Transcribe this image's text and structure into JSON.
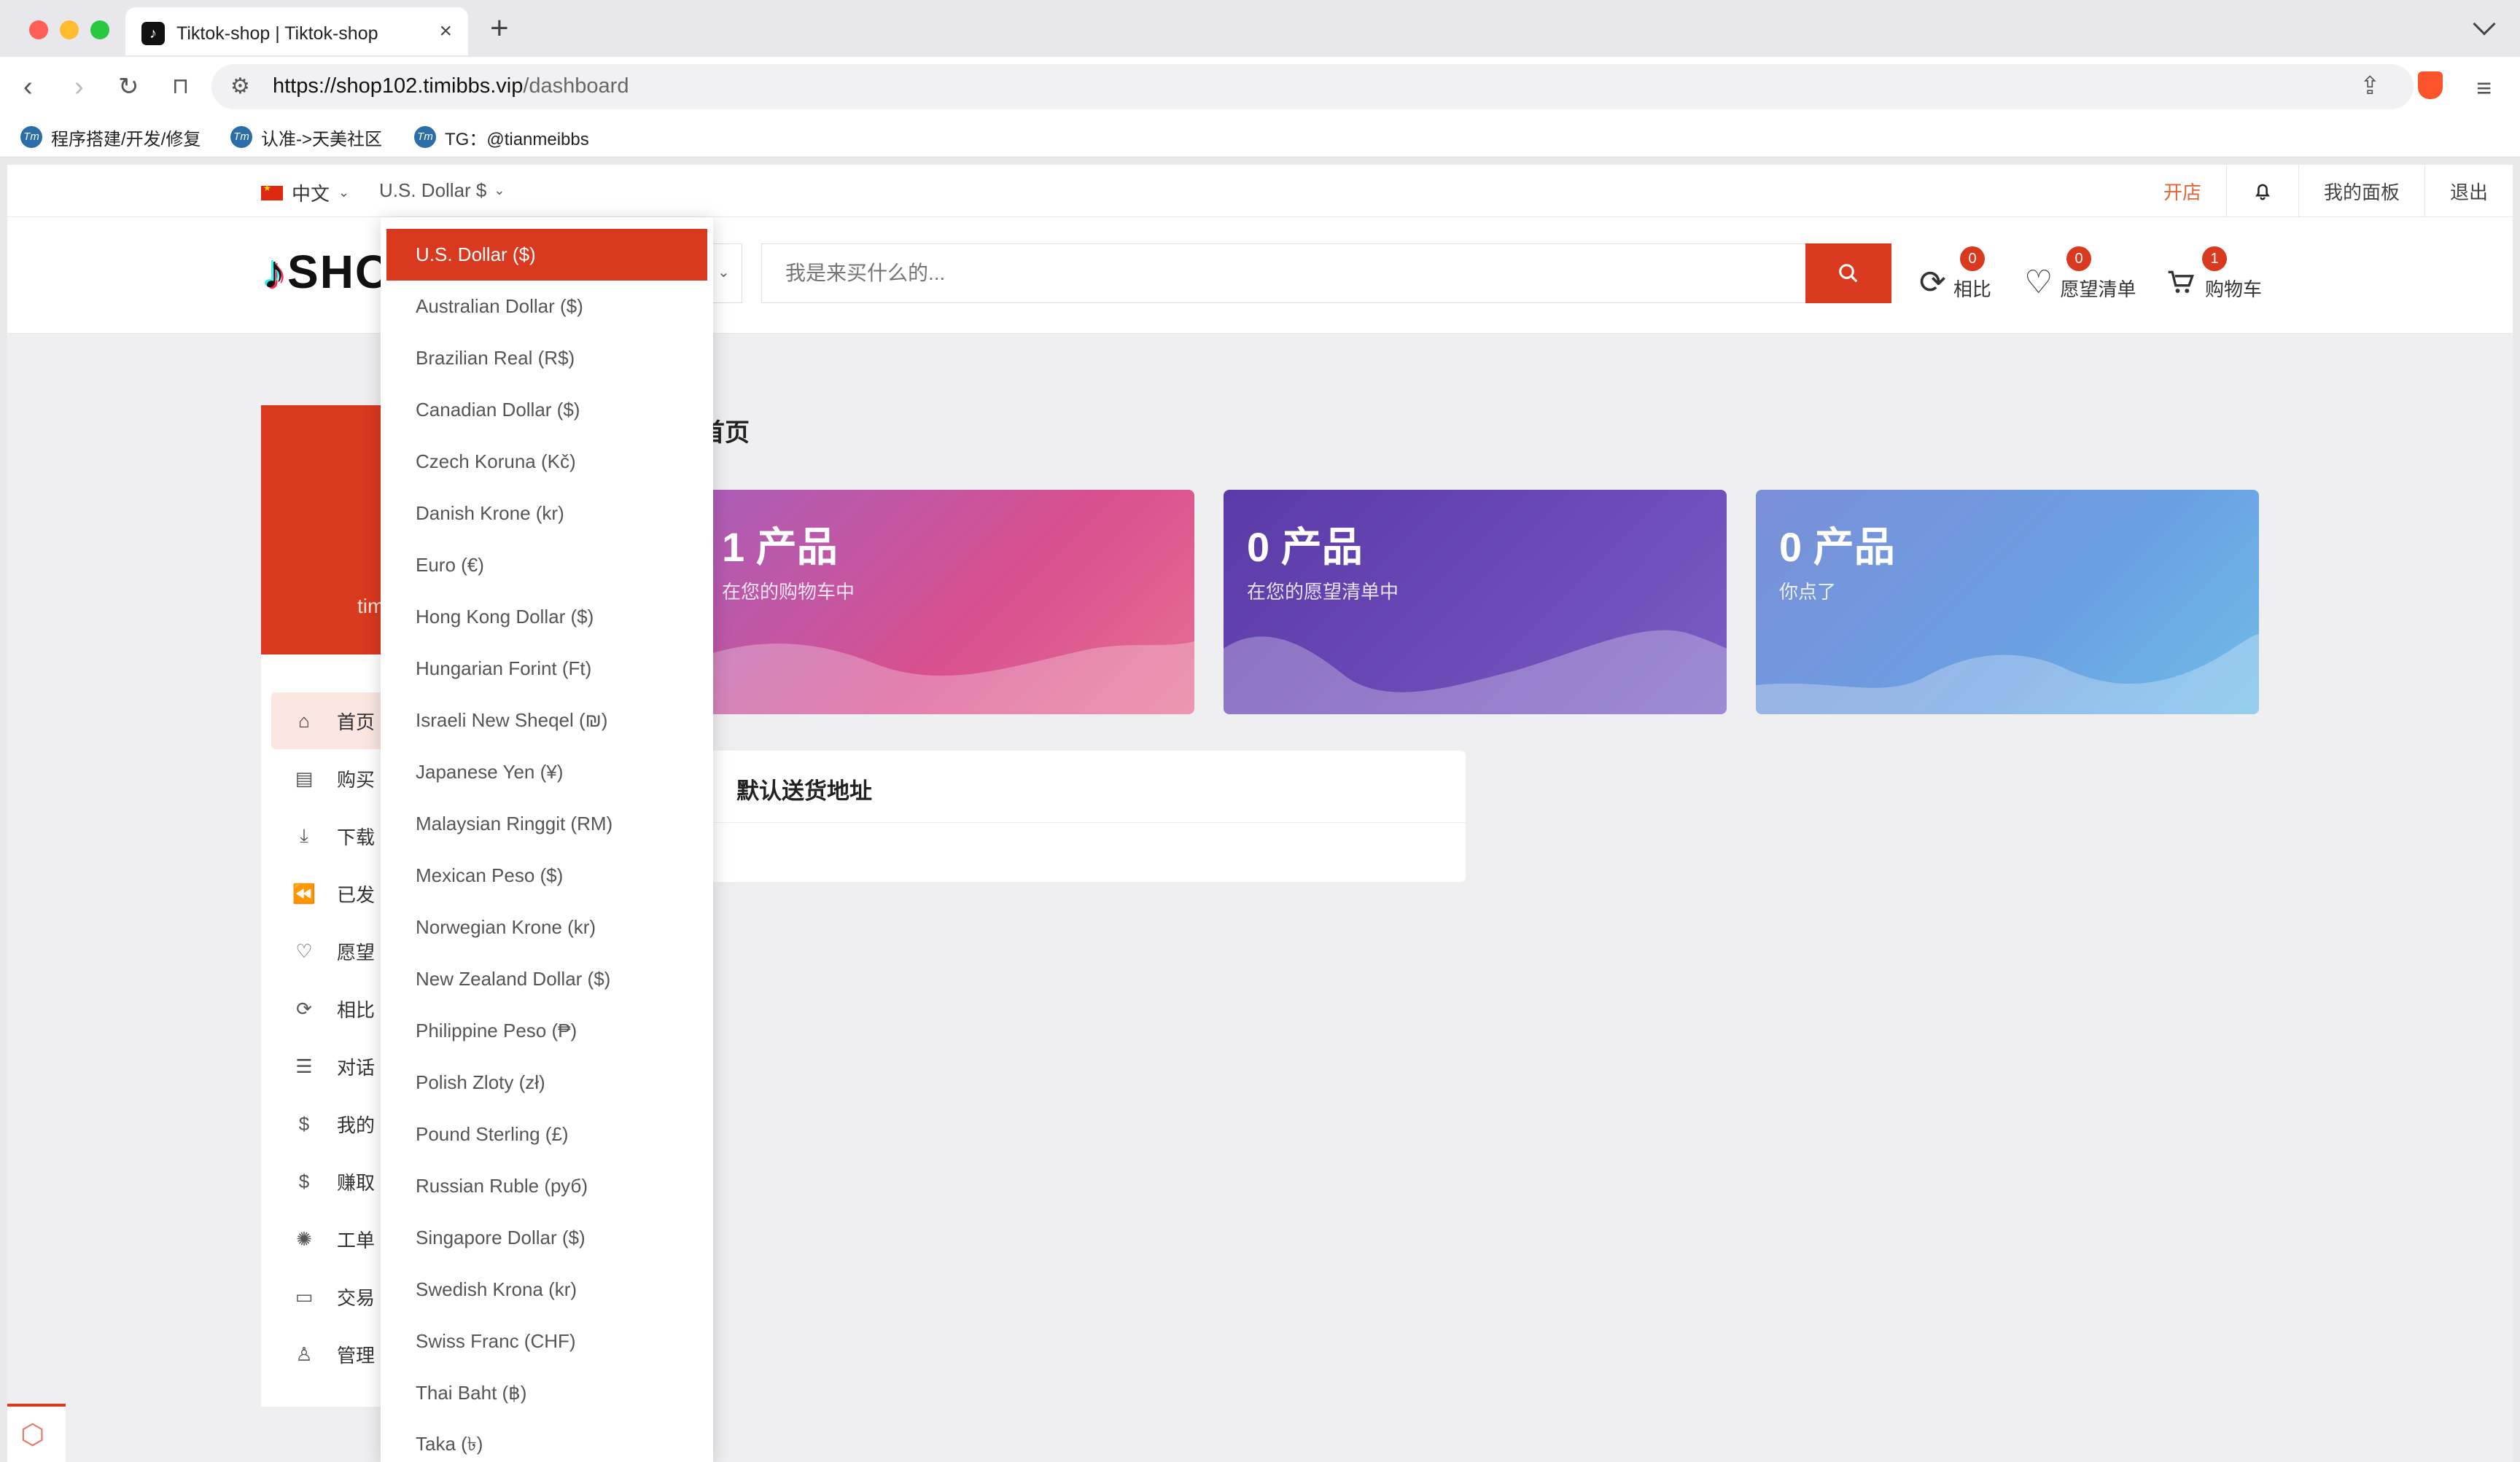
{
  "browser": {
    "tab_title": "Tiktok-shop | Tiktok-shop",
    "url_host": "https://shop102.timibbs.vip",
    "url_path": "/dashboard",
    "bookmarks": [
      "程序搭建/开发/修复",
      "认准->天美社区",
      "TG：@tianmeibbs"
    ]
  },
  "topbar": {
    "language": "中文",
    "currency": "U.S. Dollar $",
    "open_store": "开店",
    "dashboard": "我的面板",
    "logout": "退出"
  },
  "header": {
    "logo": "SHO",
    "search_placeholder": "我是来买什么的...",
    "compare": {
      "label": "相比",
      "count": "0"
    },
    "wishlist": {
      "label": "愿望清单",
      "count": "0"
    },
    "cart": {
      "label": "购物车",
      "count": "1"
    }
  },
  "sidebar": {
    "user": "tim",
    "items": [
      "首页",
      "购买",
      "下载",
      "已发",
      "愿望",
      "相比",
      "对话",
      "我的",
      "赚取",
      "工单",
      "交易",
      "管理"
    ]
  },
  "main": {
    "breadcrumb": "首页",
    "cards": [
      {
        "num": "1 产品",
        "sub": "在您的购物车中"
      },
      {
        "num": "0 产品",
        "sub": "在您的愿望清单中"
      },
      {
        "num": "0 产品",
        "sub": "你点了"
      }
    ],
    "default_address_title": "默认送货地址"
  },
  "currency_dropdown": {
    "selected": "U.S. Dollar ($)",
    "options": [
      "U.S. Dollar ($)",
      "Australian Dollar ($)",
      "Brazilian Real (R$)",
      "Canadian Dollar ($)",
      "Czech Koruna (Kč)",
      "Danish Krone (kr)",
      "Euro (€)",
      "Hong Kong Dollar ($)",
      "Hungarian Forint (Ft)",
      "Israeli New Sheqel (₪)",
      "Japanese Yen (¥)",
      "Malaysian Ringgit (RM)",
      "Mexican Peso ($)",
      "Norwegian Krone (kr)",
      "New Zealand Dollar ($)",
      "Philippine Peso (₱)",
      "Polish Zloty (zł)",
      "Pound Sterling (£)",
      "Russian Ruble (руб)",
      "Singapore Dollar ($)",
      "Swedish Krona (kr)",
      "Swiss Franc (CHF)",
      "Thai Baht (฿)",
      "Taka (৳)"
    ]
  },
  "colors": {
    "brand": "#d9391e",
    "card1_from": "#c064a4",
    "card2": "#6645b0",
    "card3": "#6b9ae0"
  }
}
